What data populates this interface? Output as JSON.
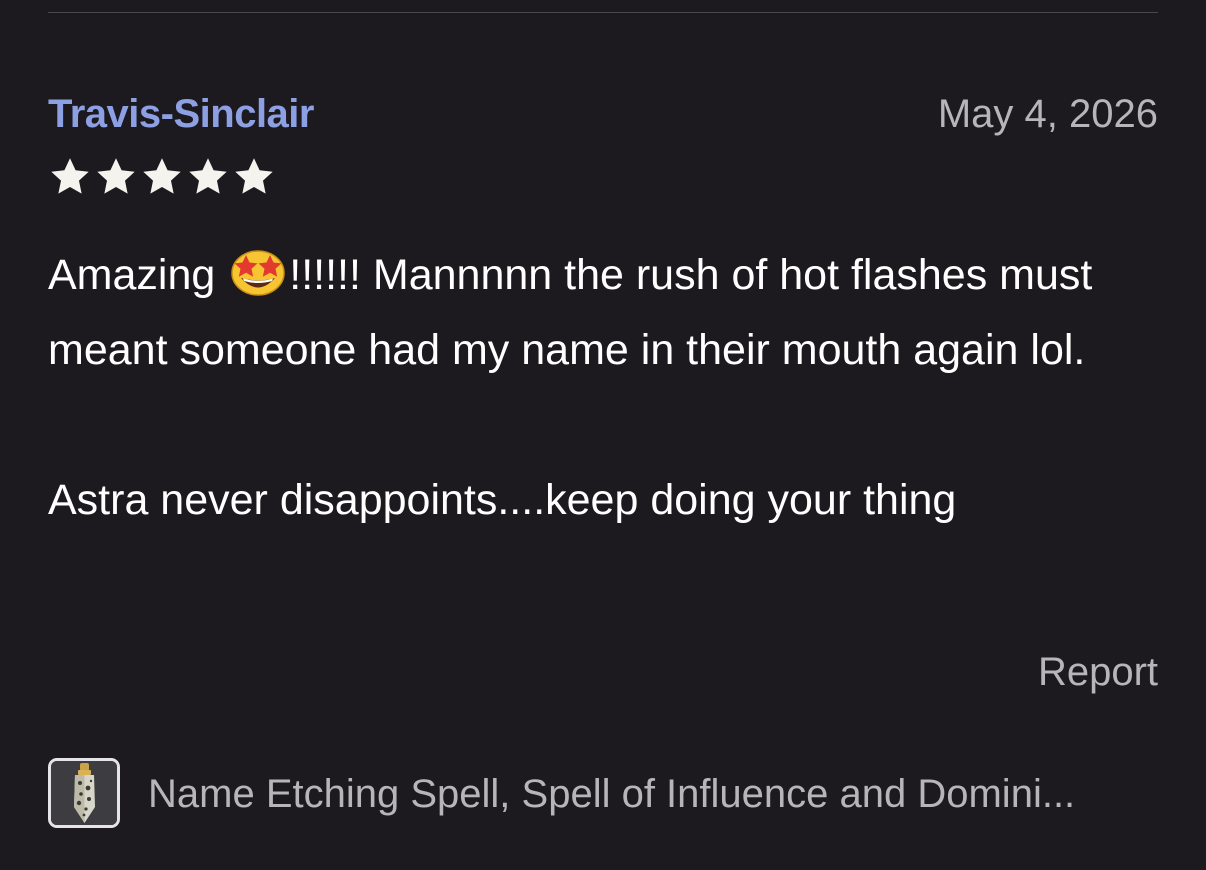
{
  "review": {
    "username": "Travis-Sinclair",
    "date": "May 4, 2026",
    "rating": 5,
    "rating_max": 5,
    "text_part1_before_emoji": "Amazing ",
    "emoji": "star-struck-emoji",
    "text_part1_after_emoji": "!!!!!! Mannnnn the rush of hot flashes must meant someone had my name in their mouth again lol.",
    "text_part2": "Astra never disappoints....keep doing your thing"
  },
  "actions": {
    "report_label": "Report"
  },
  "product": {
    "name": "Name Etching Spell, Spell of Influence and Domini...",
    "thumbnail_icon": "crystal-pendant-thumbnail"
  },
  "colors": {
    "background": "#1c1a1e",
    "username": "#8ea0e4",
    "secondary_text": "#b8b4bc",
    "star": "#f5f3ee"
  }
}
